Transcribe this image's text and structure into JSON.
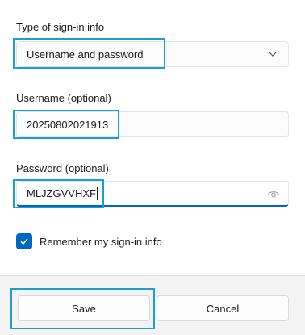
{
  "signin_type": {
    "label": "Type of sign-in info",
    "selected": "Username and password"
  },
  "username": {
    "label": "Username (optional)",
    "value": "20250802021913"
  },
  "password": {
    "label": "Password (optional)",
    "value": "MLJZGVVHXF"
  },
  "remember": {
    "label": "Remember my sign-in info",
    "checked": true
  },
  "buttons": {
    "save": "Save",
    "cancel": "Cancel"
  },
  "colors": {
    "accent": "#0067c0",
    "highlight": "#1a9ed4",
    "footer_bg": "#f3f3f3"
  }
}
